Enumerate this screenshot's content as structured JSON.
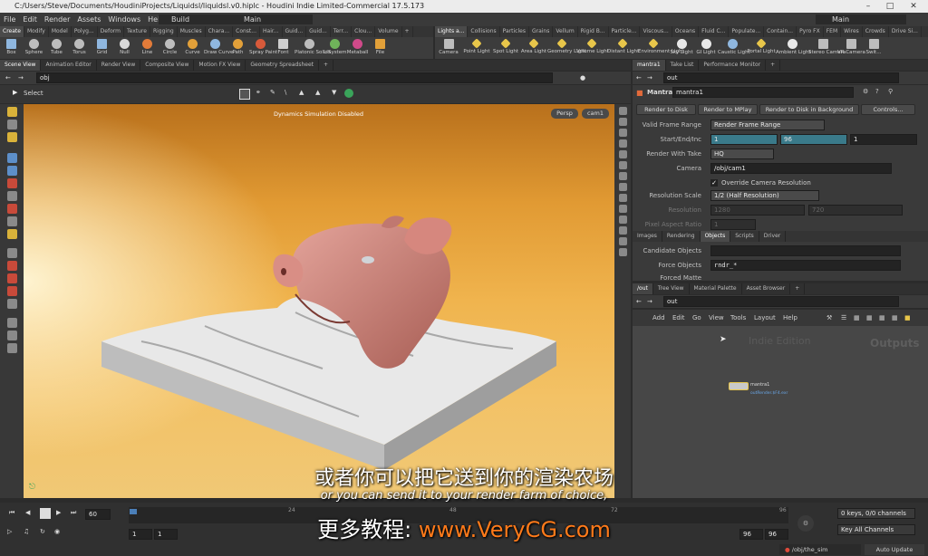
{
  "window": {
    "title": "C:/Users/Steve/Documents/HoudiniProjects/Liquidsl/liquidsl.v0.hiplc - Houdini Indie Limited-Commercial 17.5.173"
  },
  "menu": [
    "File",
    "Edit",
    "Render",
    "Assets",
    "Windows",
    "Help"
  ],
  "desktop_left": "Build",
  "desktop_center": "Main",
  "desktop_right": "Main",
  "shelf_tabs_left": [
    "Create",
    "Modify",
    "Model",
    "Polyg...",
    "Deform",
    "Texture",
    "Rigging",
    "Muscles",
    "Chara...",
    "Const...",
    "Hair...",
    "Guid...",
    "Guid...",
    "Terr...",
    "Clou...",
    "Volume"
  ],
  "shelf_tabs_right": [
    "Lights a...",
    "Collisions",
    "Particles",
    "Grains",
    "Vellum",
    "Rigid B...",
    "Particle...",
    "Viscous...",
    "Oceans",
    "Fluid C...",
    "Populate...",
    "Contain...",
    "Pyro FX",
    "FEM",
    "Wires",
    "Crowds",
    "Drive Si..."
  ],
  "tools_left": [
    "Box",
    "Sphere",
    "Tube",
    "Torus",
    "Grid",
    "Null",
    "Line",
    "Circle",
    "Curve",
    "Draw Curve",
    "Path",
    "Spray Paint",
    "Font",
    "Platonic Solids",
    "L-System",
    "Metaball",
    "File"
  ],
  "tools_right": [
    "Camera",
    "Point Light",
    "Spot Light",
    "Area Light",
    "Geometry Light",
    "Volume Light",
    "Distant Light",
    "Environment Light",
    "Sky Light",
    "GI Light",
    "Caustic Light",
    "Portal Light",
    "Ambient Light",
    "Stereo Camera",
    "VR Camera",
    "Swit..."
  ],
  "left_tabs": [
    "Scene View",
    "Animation Editor",
    "Render View",
    "Composite View",
    "Motion FX View",
    "Geometry Spreadsheet"
  ],
  "left_path": "obj",
  "viewport": {
    "tool_label": "Select",
    "status": "Dynamics Simulation Disabled",
    "persp": "Persp",
    "camera": "cam1"
  },
  "right_top_tabs": [
    "mantra1",
    "Take List",
    "Performance Monitor"
  ],
  "right_top_path": "out",
  "mantra": {
    "node_type": "Mantra",
    "node_name": "mantra1",
    "buttons": [
      "Render to Disk",
      "Render to MPlay",
      "Render to Disk in Background",
      "Controls..."
    ],
    "valid_frame_range_label": "Valid Frame Range",
    "valid_frame_range_value": "Render Frame Range",
    "start_end_inc_label": "Start/End/Inc",
    "start": "1",
    "end": "96",
    "inc": "1",
    "render_with_take_label": "Render With Take",
    "render_with_take_value": "HQ",
    "camera_label": "Camera",
    "camera_value": "/obj/cam1",
    "override_label": "Override Camera Resolution",
    "res_scale_label": "Resolution Scale",
    "res_scale_value": "1/2 (Half Resolution)",
    "resolution_label": "Resolution",
    "res_x": "1280",
    "res_y": "720",
    "pixel_aspect_label": "Pixel Aspect Ratio",
    "pixel_aspect_value": "1",
    "sub_tabs": [
      "Images",
      "Rendering",
      "Objects",
      "Scripts",
      "Driver"
    ],
    "candidate_label": "Candidate Objects",
    "candidate_value": "",
    "force_label": "Force Objects",
    "force_value": "rndr_*",
    "forced_matte_label": "Forced Matte"
  },
  "network_tabs": [
    "/out",
    "Tree View",
    "Material Palette",
    "Asset Browser"
  ],
  "network_path": "out",
  "network_menu": [
    "Add",
    "Edit",
    "Go",
    "View",
    "Tools",
    "Layout",
    "Help"
  ],
  "network": {
    "watermark": "Indie Edition",
    "context_label": "Outputs",
    "node_name": "mantra1",
    "node_sub": "outRender.$F4.exr"
  },
  "subtitles": {
    "cn": "或者你可以把它送到你的渲染农场",
    "en": "or you can send it to your render farm of choice,",
    "wm_prefix": "更多教程:",
    "wm_url": "www.VeryCG.com"
  },
  "timeline": {
    "frame": "60",
    "start": "1",
    "start2": "1",
    "end": "96",
    "end2": "96",
    "ticks": [
      "24",
      "48",
      "72",
      "96"
    ],
    "keys": "0 keys, 0/0 channels",
    "key_all": "Key All Channels",
    "path": "/obj/the_sim",
    "auto_update": "Auto Update"
  },
  "colors": {
    "accent_blue": "#4b7fb8",
    "field_teal": "#3a7a8a",
    "watermark_orange": "#ff7a1a"
  }
}
